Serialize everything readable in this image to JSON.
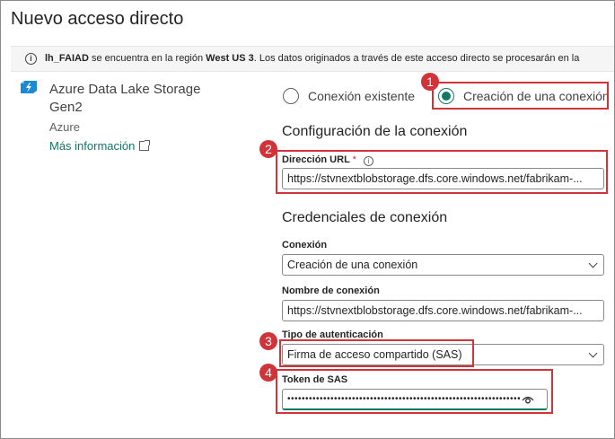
{
  "dialog": {
    "title": "Nuevo acceso directo"
  },
  "info_bar": {
    "icon": "info-icon",
    "workspace": "lh_FAIAD",
    "text_1": " se encuentra en la región ",
    "region": "West US 3",
    "text_2": ". Los datos originados a través de este acceso directo se procesarán en la"
  },
  "source": {
    "icon": "data-lake-icon",
    "name": "Azure Data Lake Storage Gen2",
    "category": "Azure",
    "more_info_link": "Más información",
    "external_icon": "external-link-icon"
  },
  "connection_mode": {
    "options": [
      {
        "label": "Conexión existente",
        "checked": false
      },
      {
        "label": "Creación de una conexión",
        "checked": true
      }
    ]
  },
  "connection_settings": {
    "title": "Configuración de la conexión",
    "url_label": "Dirección URL",
    "url_required_mark": "*",
    "url_value": "https://stvnextblobstorage.dfs.core.windows.net/fabrikam-..."
  },
  "credentials": {
    "title": "Credenciales de conexión",
    "connection_label": "Conexión",
    "connection_value": "Creación de una conexión",
    "connection_name_label": "Nombre de conexión",
    "connection_name_value": "https://stvnextblobstorage.dfs.core.windows.net/fabrikam-...",
    "auth_type_label": "Tipo de autenticación",
    "auth_type_value": "Firma de acceso compartido (SAS)",
    "sas_token_label": "Token de SAS",
    "sas_token_value": "•••••••••••••••••••••••••••••••••••••••••••••••••••••••••••••••••"
  },
  "annotations": {
    "badges": [
      "1",
      "2",
      "3",
      "4"
    ],
    "color": "#d13438"
  },
  "colors": {
    "accent": "#117865",
    "annotation": "#d13438",
    "info_bar_bg": "#f5f5f5"
  }
}
